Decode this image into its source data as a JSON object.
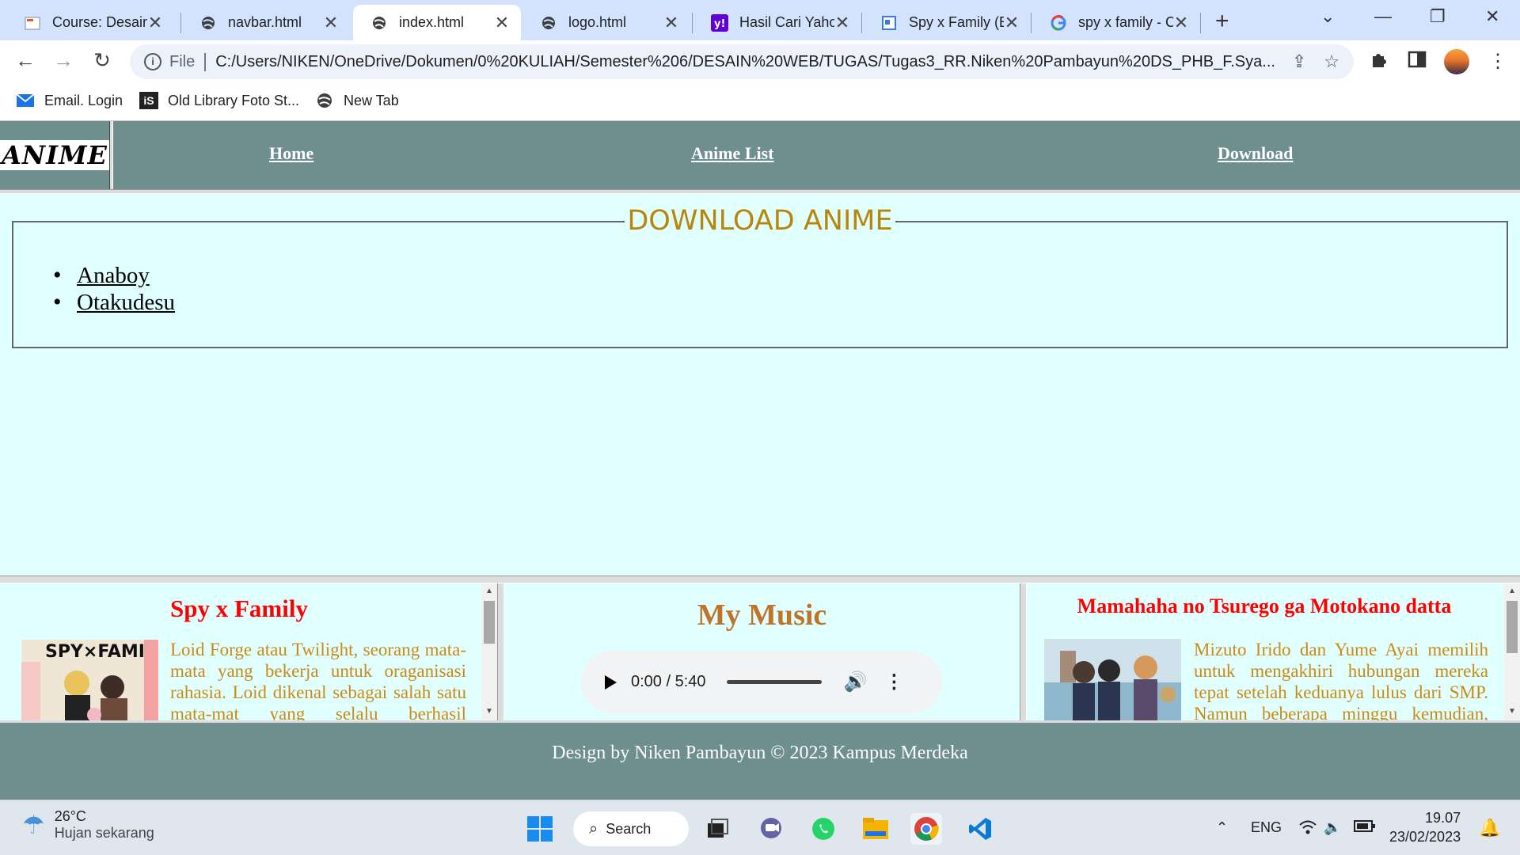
{
  "browser": {
    "tabs": [
      {
        "title": "Course: Desain"
      },
      {
        "title": "navbar.html"
      },
      {
        "title": "index.html"
      },
      {
        "title": "logo.html"
      },
      {
        "title": "Hasil Cari Yaho"
      },
      {
        "title": "Spy x Family (E"
      },
      {
        "title": "spy x family - C"
      }
    ],
    "address": {
      "scheme": "File",
      "url": "C:/Users/NIKEN/OneDrive/Dokumen/0%20KULIAH/Semester%206/DESAIN%20WEB/TUGAS/Tugas3_RR.Niken%20Pambayun%20DS_PHB_F.Sya..."
    },
    "bookmarks": [
      {
        "label": "Email. Login"
      },
      {
        "label": "Old Library Foto St..."
      },
      {
        "label": "New Tab"
      }
    ]
  },
  "page": {
    "logo_text": "ANIME",
    "nav": {
      "home": "Home",
      "anime_list": "Anime List",
      "download": "Download"
    },
    "download_section": {
      "legend": "DOWNLOAD ANIME",
      "links": [
        "Anaboy",
        "Otakudesu"
      ]
    },
    "left_panel": {
      "title": "Spy x Family",
      "image_caption": "SPY×FAMILY",
      "text": "Loid Forge atau Twilight, seorang mata-mata yang bekerja untuk oraganisasi rahasia. Loid dikenal sebagai salah satu mata-mat yang selalu berhasil menyelesaikan misinya."
    },
    "music_panel": {
      "title": "My Music",
      "time": "0:00 / 5:40"
    },
    "right_panel": {
      "title": "Mamahaha no Tsurego ga Motokano datta",
      "text": "Mizuto Irido dan Yume Ayai memilih untuk mengakhiri hubungan mereka tepat setelah keduanya lulus dari SMP. Namun beberapa minggu kemudian, mereka mendapatkan kabar bahwa"
    },
    "footer": "Design by Niken Pambayun © 2023 Kampus Merdeka"
  },
  "taskbar": {
    "temperature": "26°C",
    "weather": "Hujan sekarang",
    "search": "Search",
    "language": "ENG",
    "time": "19.07",
    "date": "23/02/2023"
  }
}
